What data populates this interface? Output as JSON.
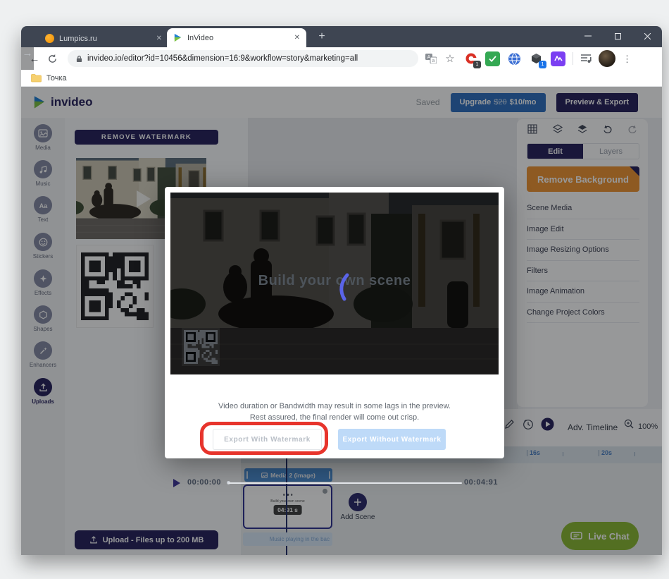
{
  "browser": {
    "tab1": "Lumpics.ru",
    "tab2": "InVideo",
    "url": "invideo.io/editor?id=10456&dimension=16:9&workflow=story&marketing=all",
    "bookmark_folder": "Точка"
  },
  "header": {
    "logo_text": "invideo",
    "saved": "Saved",
    "upgrade_prefix": "Upgrade",
    "upgrade_old_price": "$20",
    "upgrade_price": "$10/mo",
    "preview_export": "Preview & Export"
  },
  "sidebar": {
    "items": [
      "Media",
      "Music",
      "Text",
      "Stickers",
      "Effects",
      "Shapes",
      "Enhancers",
      "Uploads"
    ]
  },
  "left_panel": {
    "remove_watermark": "REMOVE WATERMARK",
    "upload_button": "Upload - Files up to 200 MB"
  },
  "right_panel": {
    "tab_edit": "Edit",
    "tab_layers": "Layers",
    "remove_background": "Remove Background",
    "items": [
      "Scene Media",
      "Image Edit",
      "Image Resizing Options",
      "Filters",
      "Image Animation",
      "Change Project Colors"
    ]
  },
  "modal": {
    "scene_title": "Build your own scene",
    "time_current": "00:00:00",
    "time_total": "00:04:91",
    "note_line1": "Video duration or Bandwidth may result in some lags in the preview.",
    "note_line2": "Rest assured, the final render will come out crisp.",
    "export_with": "Export With Watermark",
    "export_without": "Export Without Watermark"
  },
  "timeline": {
    "adv_label": "Adv. Timeline",
    "zoom_level": "100%",
    "ticks": [
      "16s",
      "20s"
    ],
    "media_label": "Media 2 (image)",
    "scene_mini_label": "Build your own scene",
    "duration_badge": "04:91 s",
    "add_scene": "Add Scene",
    "music_label": "Music playing in the bac",
    "live_chat": "Live Chat"
  },
  "colors": {
    "brand_navy": "#26225c",
    "upgrade_blue": "#2f6fc0",
    "remove_bg_orange": "#ef9433",
    "live_chat_green": "#8ab933",
    "annotation_red": "#e7342c",
    "track_blue": "#4d8fd6"
  }
}
